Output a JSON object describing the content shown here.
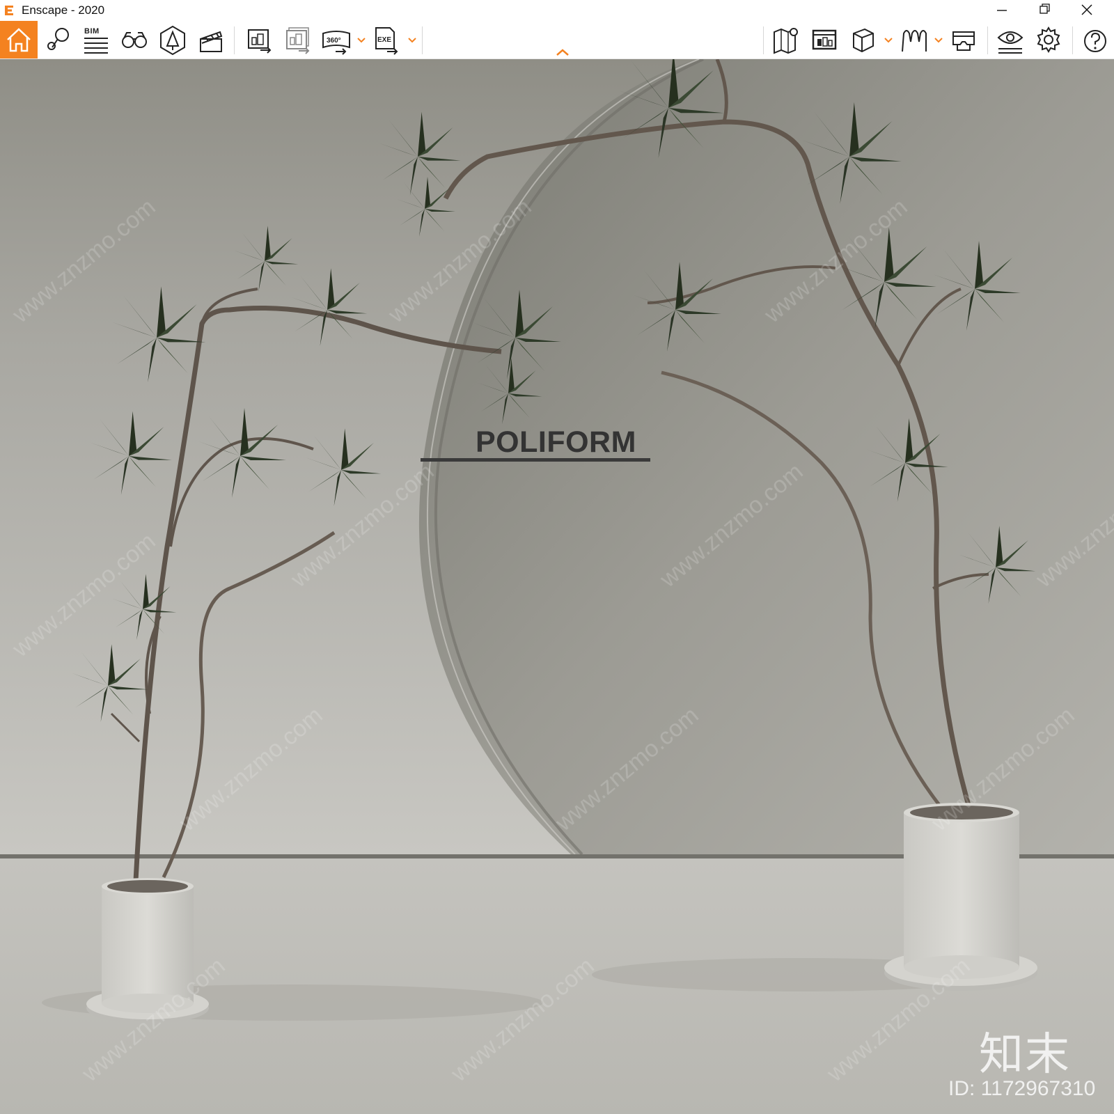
{
  "window": {
    "title": "Enscape - 2020",
    "accent": "#f48220"
  },
  "toolbar": {
    "left_buttons": [
      {
        "name": "home-icon",
        "label": "Home"
      },
      {
        "name": "map-pin-icon",
        "label": "Views"
      },
      {
        "name": "bim-icon",
        "label": "BIM"
      },
      {
        "name": "binoculars-icon",
        "label": "Asset Library"
      },
      {
        "name": "tree-shape-icon",
        "label": "Assets"
      },
      {
        "name": "clapperboard-icon",
        "label": "Video Editor"
      },
      {
        "name": "render-export-icon",
        "label": "Screenshot"
      },
      {
        "name": "batch-export-icon",
        "label": "Batch Render"
      },
      {
        "name": "pano-360-icon",
        "label": "360"
      },
      {
        "name": "exe-export-icon",
        "label": "EXE"
      }
    ],
    "bim_label": "BIM",
    "pano_label": "360°",
    "exe_label": "EXE",
    "right_buttons": [
      {
        "name": "map-icon",
        "label": "Map"
      },
      {
        "name": "web-export-icon",
        "label": "Web"
      },
      {
        "name": "cube-icon",
        "label": "Cube"
      },
      {
        "name": "people-icon",
        "label": "People"
      },
      {
        "name": "vr-headset-icon",
        "label": "VR"
      },
      {
        "name": "eye-settings-icon",
        "label": "Visual Settings"
      },
      {
        "name": "gear-icon",
        "label": "Settings"
      },
      {
        "name": "help-icon",
        "label": "?"
      }
    ]
  },
  "viewport": {
    "brand_text": "POLIFORM",
    "watermark_logo": "知末",
    "watermark_id": "ID: 1172967310",
    "watermark_url": "www.znzmo.com"
  }
}
